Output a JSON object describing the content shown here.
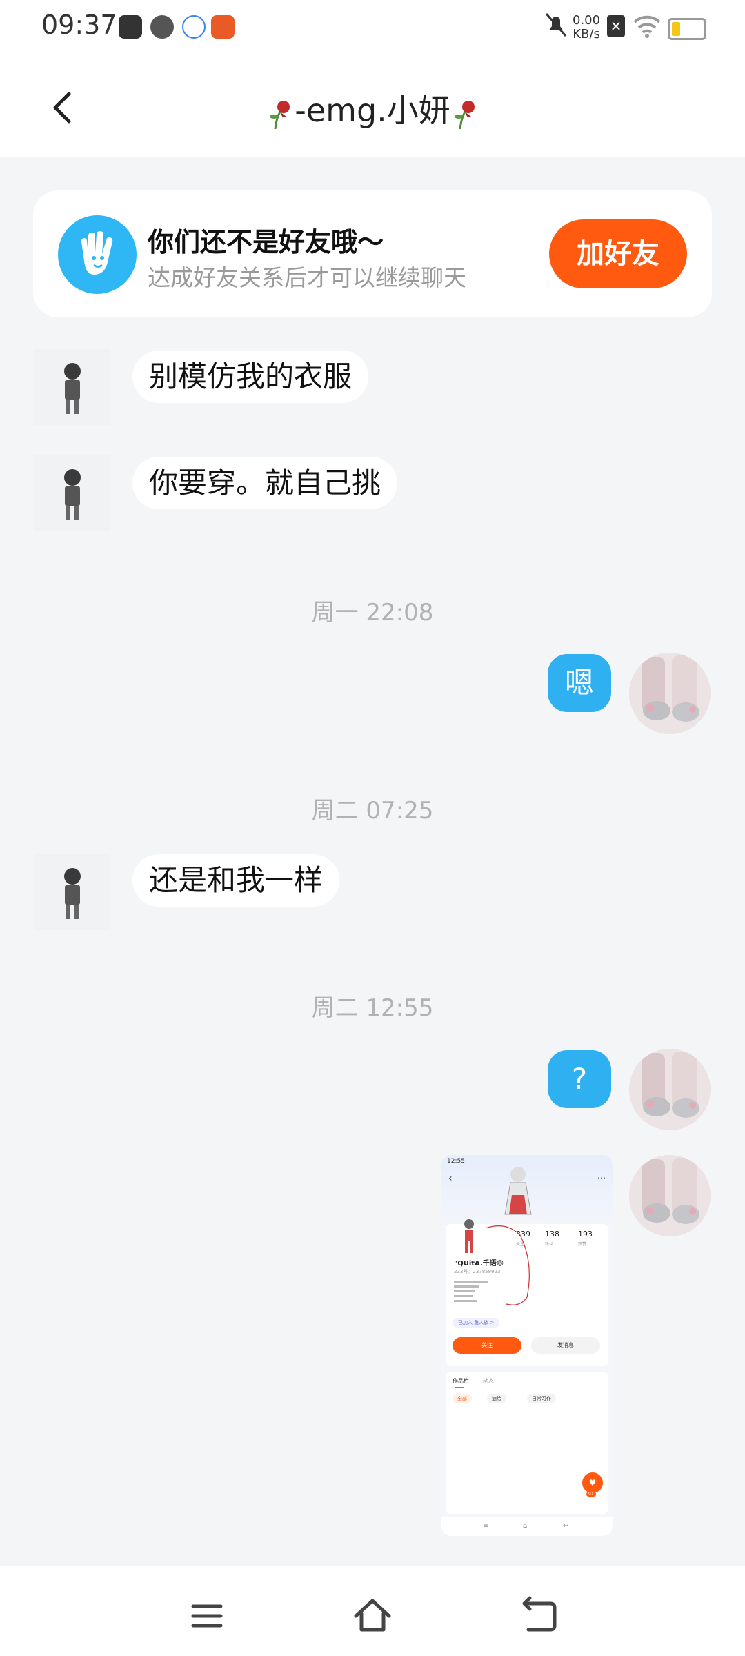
{
  "status_bar": {
    "time": "09:37",
    "net_speed_value": "0.00",
    "net_speed_unit": "KB/s"
  },
  "header": {
    "title": "-emg.小妍"
  },
  "friend_card": {
    "title": "你们还不是好友哦～",
    "subtitle": "达成好友关系后才可以继续聊天",
    "button": "加好友"
  },
  "messages": [
    {
      "side": "left",
      "text": "别模仿我的衣服"
    },
    {
      "side": "left",
      "text": "你要穿。就自己挑"
    },
    {
      "timestamp": "周一 22:08"
    },
    {
      "side": "right",
      "text": "嗯"
    },
    {
      "timestamp": "周二 07:25"
    },
    {
      "side": "left",
      "text": "还是和我一样"
    },
    {
      "timestamp": "周二 12:55"
    },
    {
      "side": "right",
      "text": "?"
    },
    {
      "side": "right",
      "type": "image"
    }
  ],
  "shared_screenshot": {
    "time": "12:55",
    "stats": [
      "339",
      "138",
      "193"
    ],
    "stat_labels": [
      "关注",
      "粉丝",
      "获赞"
    ],
    "name": "\"QUitA.千语😄",
    "id": "233号：237859923",
    "tag_pill": "已加入 鱼人族 >",
    "follow_btn": "关注",
    "message_btn": "发消息",
    "tabs": [
      "作品栏",
      "动态"
    ],
    "chips": [
      "全部",
      "速绘",
      "日常习作"
    ],
    "fab_count": "91"
  },
  "colors": {
    "accent_orange": "#ff5a0f",
    "bubble_blue": "#2fb1f1",
    "background": "#f4f5f7"
  }
}
